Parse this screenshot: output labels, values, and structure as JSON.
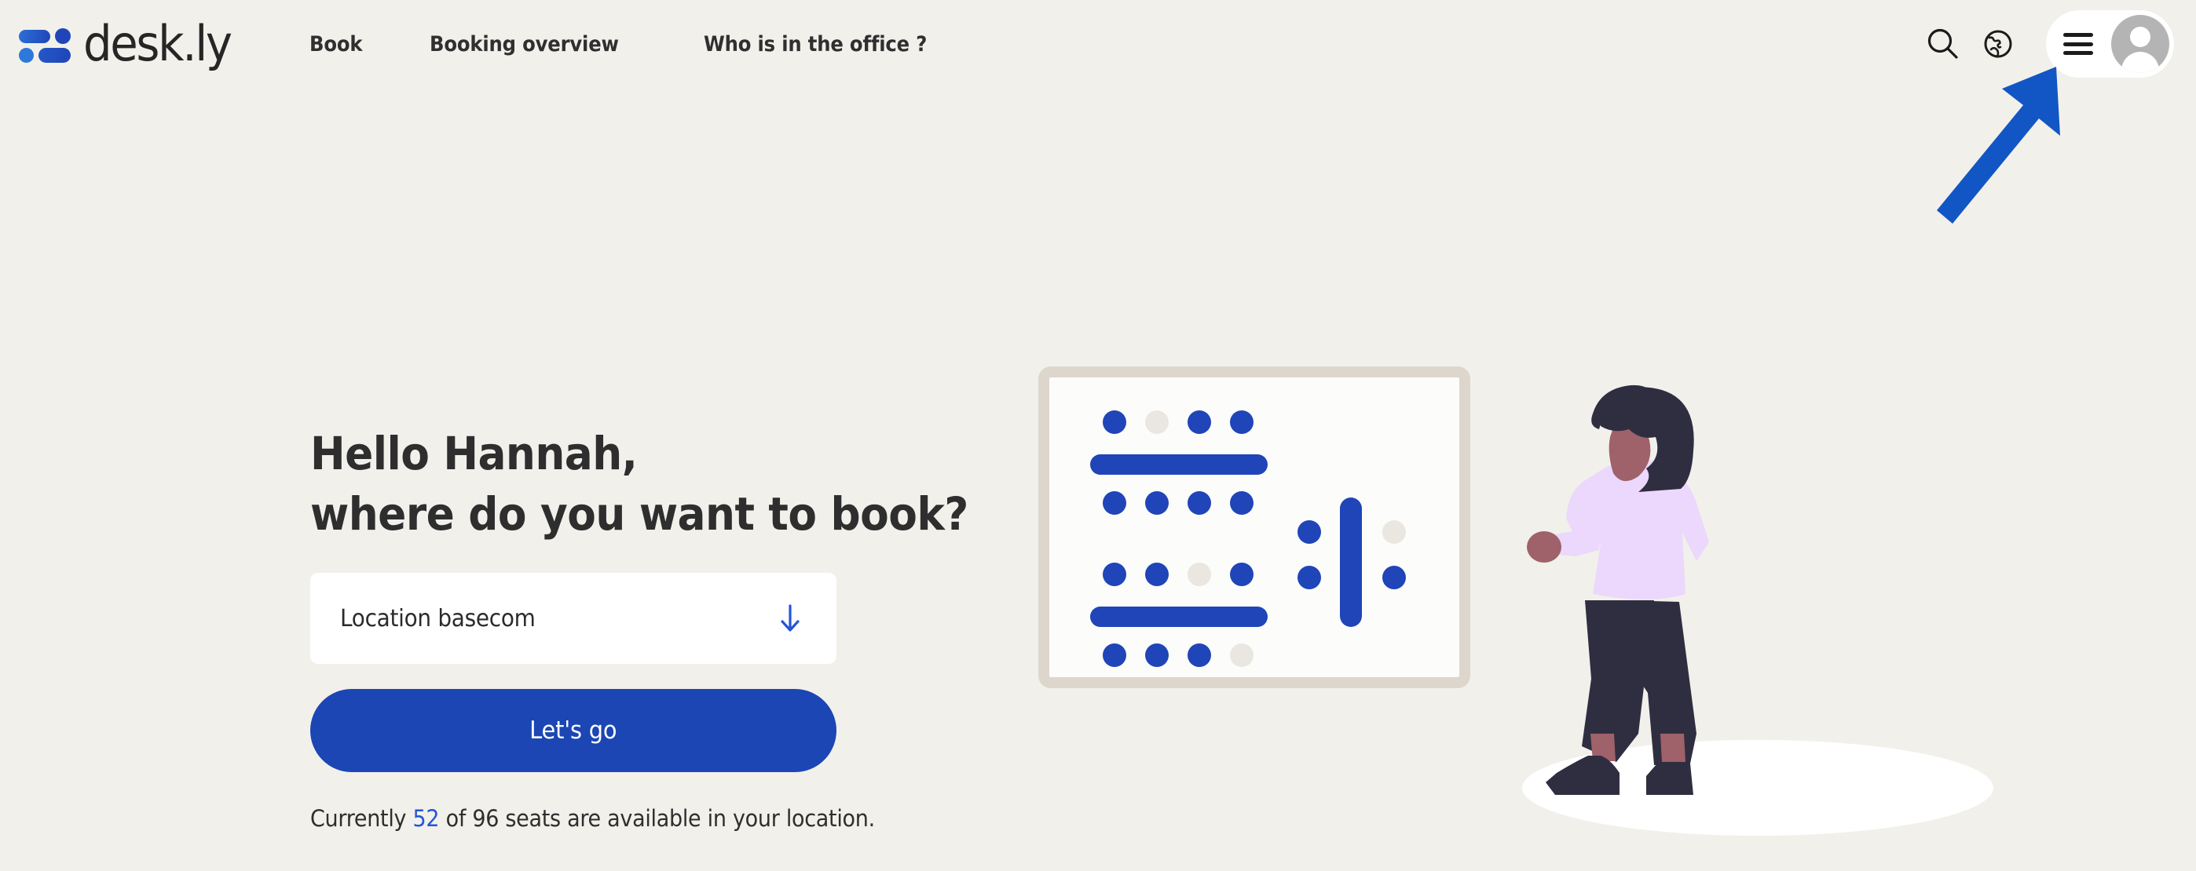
{
  "brand": {
    "name": "desk.ly",
    "logo_icon": "deskly-people-logo-icon"
  },
  "nav": {
    "items": [
      {
        "label": "Book",
        "name": "nav-item-book"
      },
      {
        "label": "Booking overview",
        "name": "nav-item-booking-overview"
      },
      {
        "label": "Who is in the office ?",
        "name": "nav-item-who-is-in-the-office"
      }
    ]
  },
  "header_actions": {
    "search_icon": "search-icon",
    "language_icon": "globe-icon",
    "menu_icon": "hamburger-menu-icon",
    "avatar_icon": "user-avatar-icon"
  },
  "hero": {
    "greeting_line1": "Hello Hannah,",
    "greeting_line2": "where do you want to book?",
    "user_name": "Hannah"
  },
  "location_select": {
    "value": "Location basecom",
    "placeholder": "Location basecom",
    "chevron_icon": "arrow-down-icon"
  },
  "cta": {
    "label": "Let's go"
  },
  "availability": {
    "prefix": "Currently ",
    "available": "52",
    "suffix": " of 96 seats are available in your location.",
    "total": "96",
    "full_text": "Currently 52 of 96 seats are available in your location."
  },
  "annotation": {
    "type": "arrow",
    "points_at": "hamburger-menu-icon",
    "color": "#1156C4"
  },
  "colors": {
    "page_background": "#F2F0EB",
    "brand_blue": "#1F45B8",
    "button_blue": "#1B46B4",
    "accent_link_blue": "#2356D8",
    "card_border": "#DDD6CD",
    "card_fill": "#FCFCFB",
    "seat_free": "#EAE7E1",
    "text_dark": "#2E2E2E",
    "avatar_gray": "#B4B4B4",
    "annotation_blue": "#1156C4"
  },
  "illustration": {
    "name": "office-floorplan-and-person-illustration",
    "floorplan": {
      "desks": [
        {
          "name": "desk-row-1",
          "orientation": "horizontal",
          "seats_top": [
            "occupied",
            "free",
            "occupied",
            "occupied"
          ],
          "seats_bottom": [
            "occupied",
            "occupied",
            "occupied",
            "occupied"
          ]
        },
        {
          "name": "desk-row-2",
          "orientation": "horizontal",
          "seats_top": [
            "occupied",
            "occupied",
            "free",
            "occupied"
          ],
          "seats_bottom": [
            "occupied",
            "occupied",
            "occupied",
            "free"
          ]
        },
        {
          "name": "desk-vertical",
          "orientation": "vertical",
          "seats_left": [
            "occupied",
            "occupied"
          ],
          "seats_right": [
            "free",
            "occupied"
          ]
        }
      ]
    },
    "person": {
      "name": "walking-person-illustration",
      "hair_color": "#2F2E41",
      "skin_color": "#9F616A",
      "top_color": "#E9D8FD",
      "pants_color": "#2F2E41",
      "shoe_color": "#2F2E41"
    }
  }
}
